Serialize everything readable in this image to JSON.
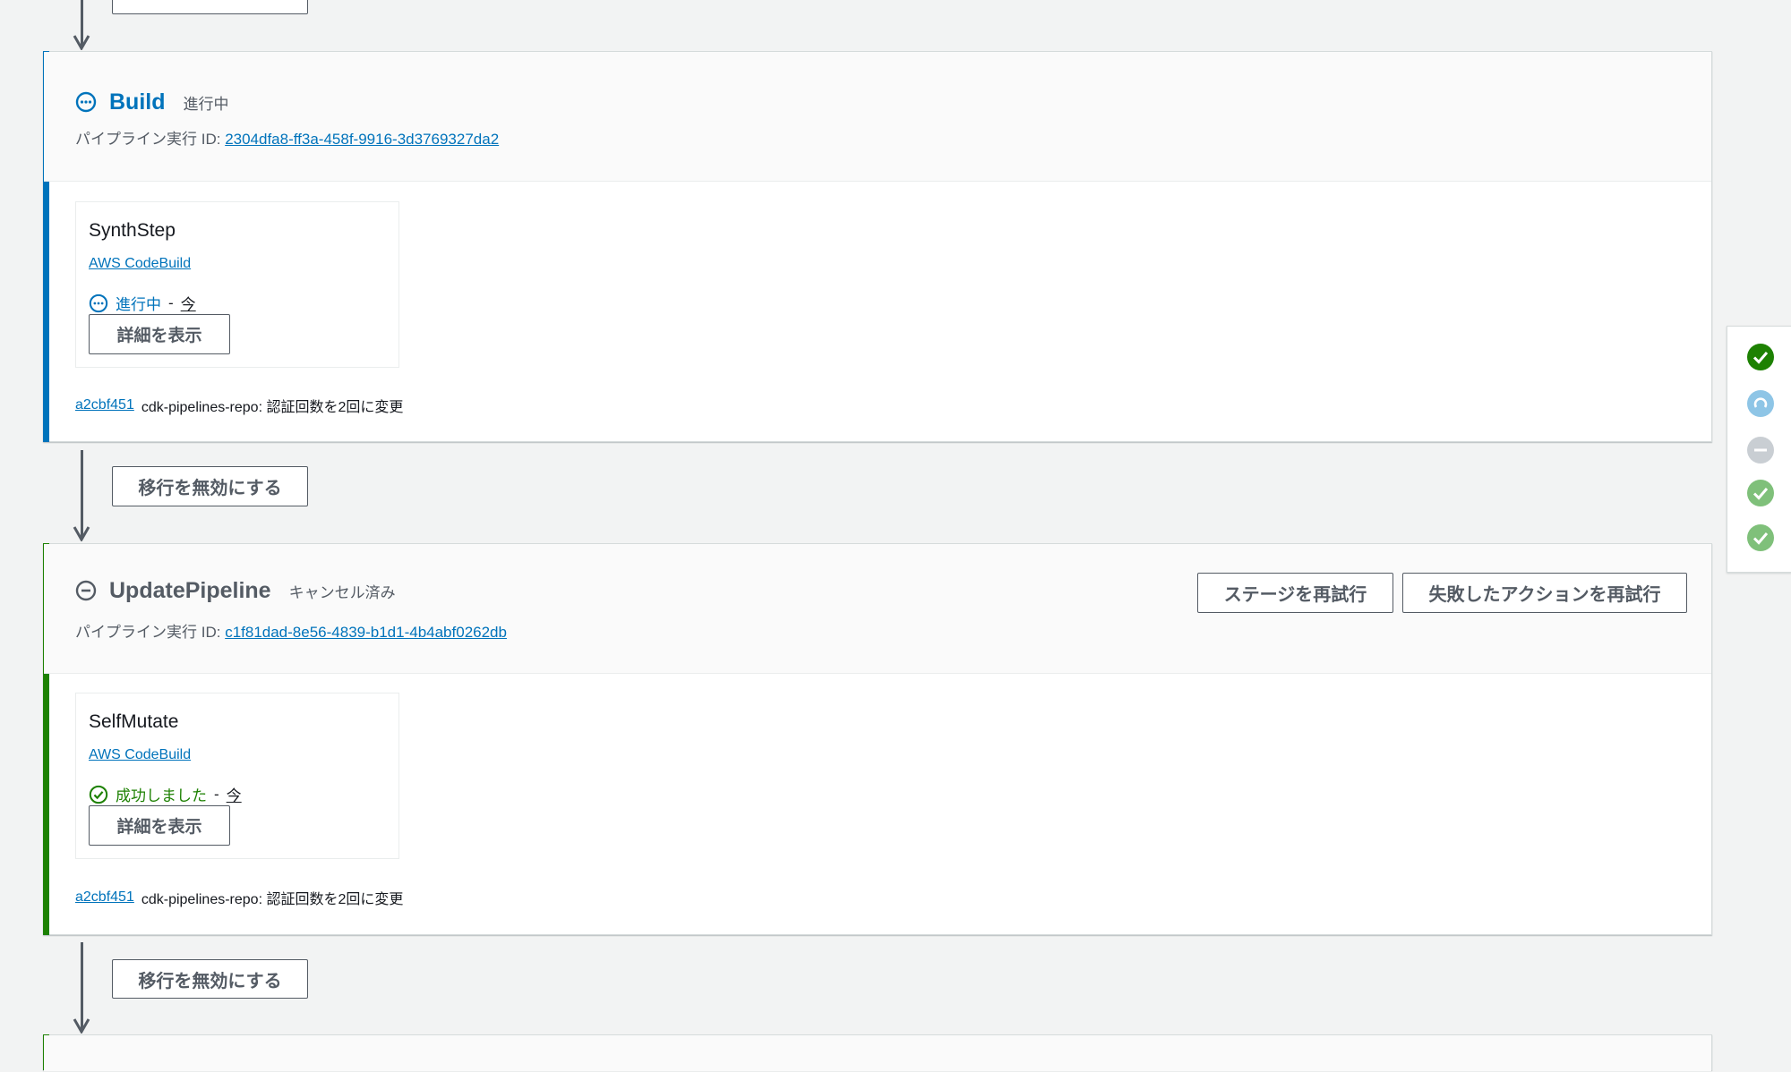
{
  "transition_label": "移行を無効にする",
  "stages": [
    {
      "name": "Build",
      "status": "進行中",
      "exec_label": "パイプライン実行 ID:",
      "exec_id": "2304dfa8-ff3a-458f-9916-3d3769327da2",
      "accent_color": "#0073bb",
      "action": {
        "name": "SynthStep",
        "provider": "AWS CodeBuild",
        "status": "進行中",
        "sep": "-",
        "time": "今",
        "details_label": "詳細を表示",
        "status_color": "#0073bb"
      },
      "commit": {
        "id": "a2cbf451",
        "message": "cdk-pipelines-repo: 認証回数を2回に変更"
      }
    },
    {
      "name": "UpdatePipeline",
      "status": "キャンセル済み",
      "exec_label": "パイプライン実行 ID:",
      "exec_id": "c1f81dad-8e56-4839-b1d1-4b4abf0262db",
      "accent_color": "#1d8102",
      "retry_stage_label": "ステージを再試行",
      "retry_failed_label": "失敗したアクションを再試行",
      "action": {
        "name": "SelfMutate",
        "provider": "AWS CodeBuild",
        "status": "成功しました",
        "sep": "-",
        "time": "今",
        "details_label": "詳細を表示",
        "status_color": "#1d8102"
      },
      "commit": {
        "id": "a2cbf451",
        "message": "cdk-pipelines-repo: 認証回数を2回に変更"
      }
    }
  ],
  "status_rail": [
    "succeeded-icon",
    "in-progress-icon",
    "cancelled-icon",
    "succeeded-icon",
    "succeeded-icon"
  ],
  "colors": {
    "in_progress": "#0073bb",
    "succeeded": "#1d8102",
    "cancelled": "#545b64",
    "background": "#f2f3f3"
  }
}
